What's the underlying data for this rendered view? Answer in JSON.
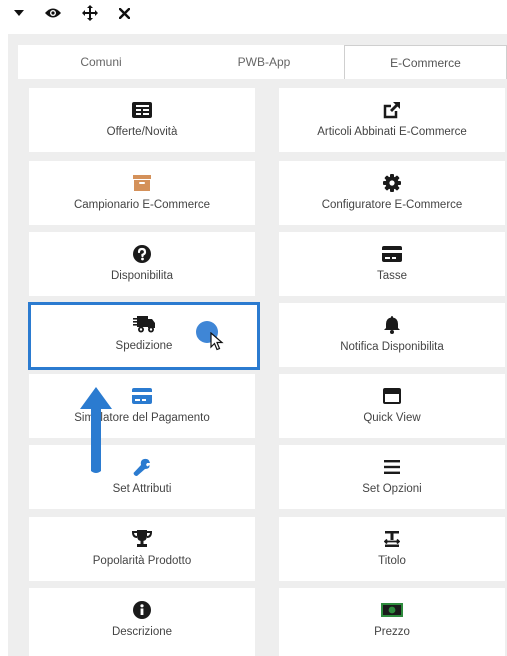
{
  "toolbar": {
    "icons": [
      "caret-down-icon",
      "eye-icon",
      "move-icon",
      "close-icon"
    ]
  },
  "tabs": [
    {
      "label": "Comuni",
      "active": false
    },
    {
      "label": "PWB-App",
      "active": false
    },
    {
      "label": "E-Commerce",
      "active": true
    }
  ],
  "tiles": [
    {
      "label": "Offerte/Novità",
      "icon": "newspaper-icon",
      "color": "#1a1a1a"
    },
    {
      "label": "Articoli Abbinati E-Commerce",
      "icon": "external-link-icon",
      "color": "#1a1a1a"
    },
    {
      "label": "Campionario E-Commerce",
      "icon": "archive-box-icon",
      "color": "#d4915a"
    },
    {
      "label": "Configuratore E-Commerce",
      "icon": "gear-icon",
      "color": "#1a1a1a"
    },
    {
      "label": "Disponibilita",
      "icon": "question-circle-icon",
      "color": "#1a1a1a"
    },
    {
      "label": "Tasse",
      "icon": "credit-card-icon",
      "color": "#1a1a1a"
    },
    {
      "label": "Spedizione",
      "icon": "shipping-fast-icon",
      "color": "#1a1a1a"
    },
    {
      "label": "Notifica Disponibilita",
      "icon": "bell-icon",
      "color": "#1a1a1a"
    },
    {
      "label": "Simulatore del Pagamento",
      "icon": "credit-card-icon",
      "color": "#2b7bd0"
    },
    {
      "label": "Quick View",
      "icon": "window-icon",
      "color": "#1a1a1a"
    },
    {
      "label": "Set Attributi",
      "icon": "wrench-icon",
      "color": "#2b7bd0"
    },
    {
      "label": "Set Opzioni",
      "icon": "bars-icon",
      "color": "#1a1a1a"
    },
    {
      "label": "Popolarità Prodotto",
      "icon": "trophy-icon",
      "color": "#1a1a1a"
    },
    {
      "label": "Titolo",
      "icon": "text-height-icon",
      "color": "#1a1a1a"
    },
    {
      "label": "Descrizione",
      "icon": "info-circle-icon",
      "color": "#1a1a1a"
    },
    {
      "label": "Prezzo",
      "icon": "money-bill-icon",
      "color": "#2e8b3d"
    }
  ],
  "colors": {
    "accent": "#2b7bd0",
    "panel": "#eeeeee",
    "tile": "#ffffff"
  }
}
